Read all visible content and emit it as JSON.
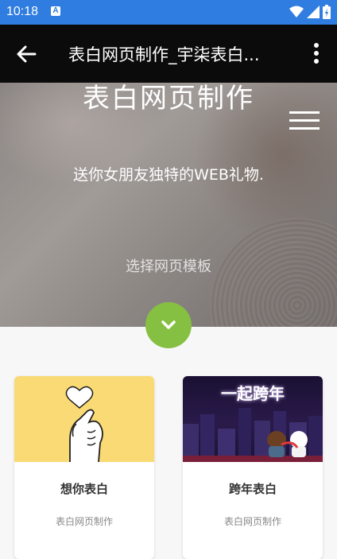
{
  "status_bar": {
    "time": "10:18",
    "notification_letter": "A"
  },
  "app_bar": {
    "title": "表白网页制作_宇柒表白..."
  },
  "hero": {
    "title": "表白网页制作",
    "subtitle": "送你女朋友独特的WEB礼物.",
    "choose_label": "选择网页模板"
  },
  "cards": [
    {
      "title": "想你表白",
      "subtitle": "表白网页制作",
      "image": "heart-hand-illustration"
    },
    {
      "title": "跨年表白",
      "subtitle": "表白网页制作",
      "image": "new-year-night-illustration",
      "image_text": "一起跨年"
    }
  ],
  "colors": {
    "status_bar": "#2f7de0",
    "app_bar": "#0b0b0b",
    "accent": "#86c042",
    "card_yellow": "#fada74"
  },
  "icons": [
    "back-arrow-icon",
    "more-vert-icon",
    "hamburger-icon",
    "chevron-down-icon",
    "wifi-icon",
    "signal-icon",
    "battery-icon"
  ]
}
